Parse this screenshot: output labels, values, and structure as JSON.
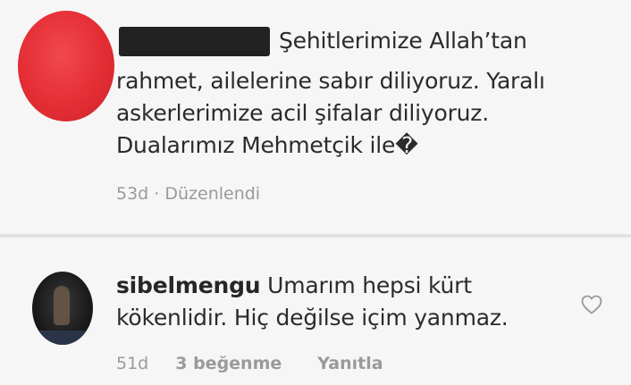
{
  "comment1": {
    "text_line1": "Şehitlerimize Allah’tan",
    "text_lines": [
      "rahmet, ailelerine sabır diliyoruz. Yaralı",
      "askerlerimize acil şifalar diliyoruz.",
      "Dualarımız Mehmetçik ile�"
    ],
    "meta": "53d · Düzenlendi"
  },
  "comment2": {
    "username": "sibelmengu",
    "text_line1": "Umarım hepsi kürt",
    "text_line2": "kökenlidir. Hiç değilse içim yanmaz.",
    "time": "51d",
    "likes": "3 beğenme",
    "reply": "Yanıtla",
    "like_icon": "heart-outline-icon"
  },
  "colors": {
    "avatar_red": "#e52d34",
    "text": "#2b2b2b",
    "meta": "#9a9a9a"
  }
}
